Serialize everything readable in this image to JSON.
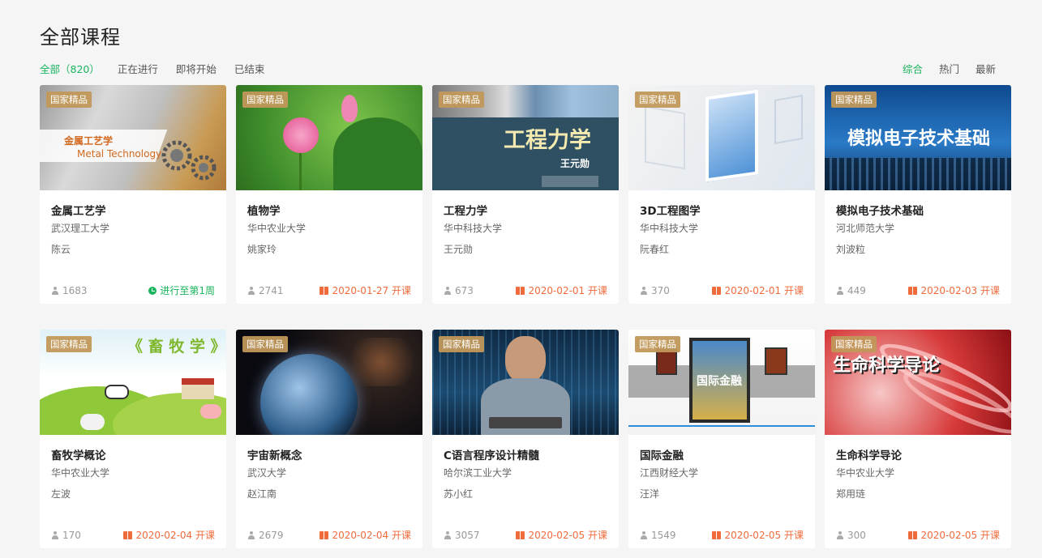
{
  "page": {
    "title": "全部课程"
  },
  "filters": [
    {
      "label": "全部（820）",
      "active": true
    },
    {
      "label": "正在进行",
      "active": false
    },
    {
      "label": "即将开始",
      "active": false
    },
    {
      "label": "已结束",
      "active": false
    }
  ],
  "sorts": [
    {
      "label": "综合",
      "active": true
    },
    {
      "label": "热门",
      "active": false
    },
    {
      "label": "最新",
      "active": false
    }
  ],
  "badge_label": "国家精品",
  "colors": {
    "accent_green": "#1bb45e",
    "accent_orange": "#f06b3c",
    "badge_gold": "#c1985a"
  },
  "courses": [
    {
      "title": "金属工艺学",
      "school": "武汉理工大学",
      "teacher": "陈云",
      "enrolled": "1683",
      "status": "进行至第1周",
      "status_type": "ongoing",
      "cover_text": "金属工艺学",
      "cover_subtext": "Metal Technology"
    },
    {
      "title": "植物学",
      "school": "华中农业大学",
      "teacher": "姚家玲",
      "enrolled": "2741",
      "status": "2020-01-27 开课",
      "status_type": "upcoming",
      "cover_text": "",
      "cover_subtext": ""
    },
    {
      "title": "工程力学",
      "school": "华中科技大学",
      "teacher": "王元勋",
      "enrolled": "673",
      "status": "2020-02-01 开课",
      "status_type": "upcoming",
      "cover_text": "工程力学",
      "cover_subtext": "王元勋"
    },
    {
      "title": "3D工程图学",
      "school": "华中科技大学",
      "teacher": "阮春红",
      "enrolled": "370",
      "status": "2020-02-01 开课",
      "status_type": "upcoming",
      "cover_text": "",
      "cover_subtext": ""
    },
    {
      "title": "模拟电子技术基础",
      "school": "河北师范大学",
      "teacher": "刘波粒",
      "enrolled": "449",
      "status": "2020-02-03 开课",
      "status_type": "upcoming",
      "cover_text": "模拟电子技术基础",
      "cover_subtext": ""
    },
    {
      "title": "畜牧学概论",
      "school": "华中农业大学",
      "teacher": "左波",
      "enrolled": "170",
      "status": "2020-02-04 开课",
      "status_type": "upcoming",
      "cover_text": "《 畜 牧 学 》",
      "cover_subtext": ""
    },
    {
      "title": "宇宙新概念",
      "school": "武汉大学",
      "teacher": "赵江南",
      "enrolled": "2679",
      "status": "2020-02-04 开课",
      "status_type": "upcoming",
      "cover_text": "",
      "cover_subtext": ""
    },
    {
      "title": "C语言程序设计精髓",
      "school": "哈尔滨工业大学",
      "teacher": "苏小红",
      "enrolled": "3057",
      "status": "2020-02-05 开课",
      "status_type": "upcoming",
      "cover_text": "",
      "cover_subtext": ""
    },
    {
      "title": "国际金融",
      "school": "江西财经大学",
      "teacher": "汪洋",
      "enrolled": "1549",
      "status": "2020-02-05 开课",
      "status_type": "upcoming",
      "cover_text": "国际金融",
      "cover_subtext": ""
    },
    {
      "title": "生命科学导论",
      "school": "华中农业大学",
      "teacher": "郑用琏",
      "enrolled": "300",
      "status": "2020-02-05 开课",
      "status_type": "upcoming",
      "cover_text": "生命科学导论",
      "cover_subtext": ""
    }
  ]
}
